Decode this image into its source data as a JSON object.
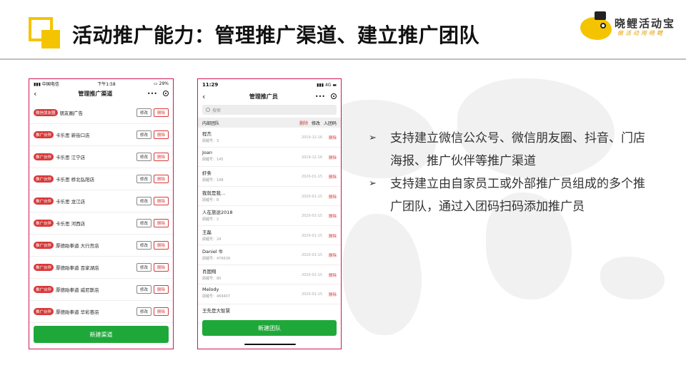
{
  "slide": {
    "title": "活动推广能力：管理推广渠道、建立推广团队",
    "brand_name": "晓鲤活动宝",
    "brand_tagline": "做活动用晓鲤"
  },
  "phone1": {
    "status_carrier": "中国电信",
    "status_time": "下午1:58",
    "status_battery": "29%",
    "nav_title": "管理推广渠道",
    "nav_back": "‹",
    "nav_more": "•••",
    "channels": [
      {
        "tag": "微信朋友圈",
        "name": "朋友圈广告"
      },
      {
        "tag": "推广伙伴",
        "name": "卡乐思 新街口店"
      },
      {
        "tag": "推广伙伴",
        "name": "卡乐思 江宁店"
      },
      {
        "tag": "推广伙伴",
        "name": "卡乐思 桥北弘阳店"
      },
      {
        "tag": "推广伙伴",
        "name": "卡乐思 龙江店"
      },
      {
        "tag": "推广伙伴",
        "name": "卡乐思 河西店"
      },
      {
        "tag": "推广伙伴",
        "name": "厚德跆拳道 大行宫店"
      },
      {
        "tag": "推广伙伴",
        "name": "厚德跆拳道 百家湖店"
      },
      {
        "tag": "推广伙伴",
        "name": "厚德跆拳道 威尼斯店"
      },
      {
        "tag": "推广伙伴",
        "name": "厚德跆拳道 华彩荟店"
      }
    ],
    "edit_label": "修改",
    "delete_label": "删除",
    "new_button": "新建渠道"
  },
  "phone2": {
    "status_time": "11:29",
    "status_net": "4G",
    "nav_title": "管理推广员",
    "nav_back": "‹",
    "nav_more": "•••",
    "search_placeholder": "搜索",
    "team_label": "内部团队",
    "team_delete": "删除",
    "team_edit": "修改",
    "team_code": "入团码",
    "members": [
      {
        "name": "程杰",
        "id": "顾鲤号：3",
        "date": "2019-12-16"
      },
      {
        "name": "Joan",
        "id": "顾鲤号：145",
        "date": "2019-12-16"
      },
      {
        "name": "虾条",
        "id": "顾鲤号：198",
        "date": "2020-01-15"
      },
      {
        "name": "我就是我…",
        "id": "顾鲤号：8",
        "date": "2020-01-15"
      },
      {
        "name": "人在旅途2018",
        "id": "顾鲤号：2",
        "date": "2020-01-15"
      },
      {
        "name": "王磊",
        "id": "顾鲤号：24",
        "date": "2020-01-15"
      },
      {
        "name": "Daniel 牛",
        "id": "顾鲤号：476639",
        "date": "2020-01-15"
      },
      {
        "name": "肖国翔",
        "id": "顾鲤号：80",
        "date": "2020-01-15"
      },
      {
        "name": "Melody",
        "id": "顾鲤号：469407",
        "date": "2020-01-15"
      },
      {
        "name": "王先是大智慧",
        "id": "",
        "date": ""
      }
    ],
    "delete_label": "删除",
    "new_button": "新建团队"
  },
  "bullets": [
    "支持建立微信公众号、微信朋友圈、抖音、门店海报、推广伙伴等推广渠道",
    "支持建立由自家员工或外部推广员组成的多个推广团队，通过入团码扫码添加推广员"
  ],
  "colors": {
    "accent": "#f5c400",
    "phone_border": "#d0155b",
    "green": "#1fa83a",
    "red": "#d63a3a"
  }
}
